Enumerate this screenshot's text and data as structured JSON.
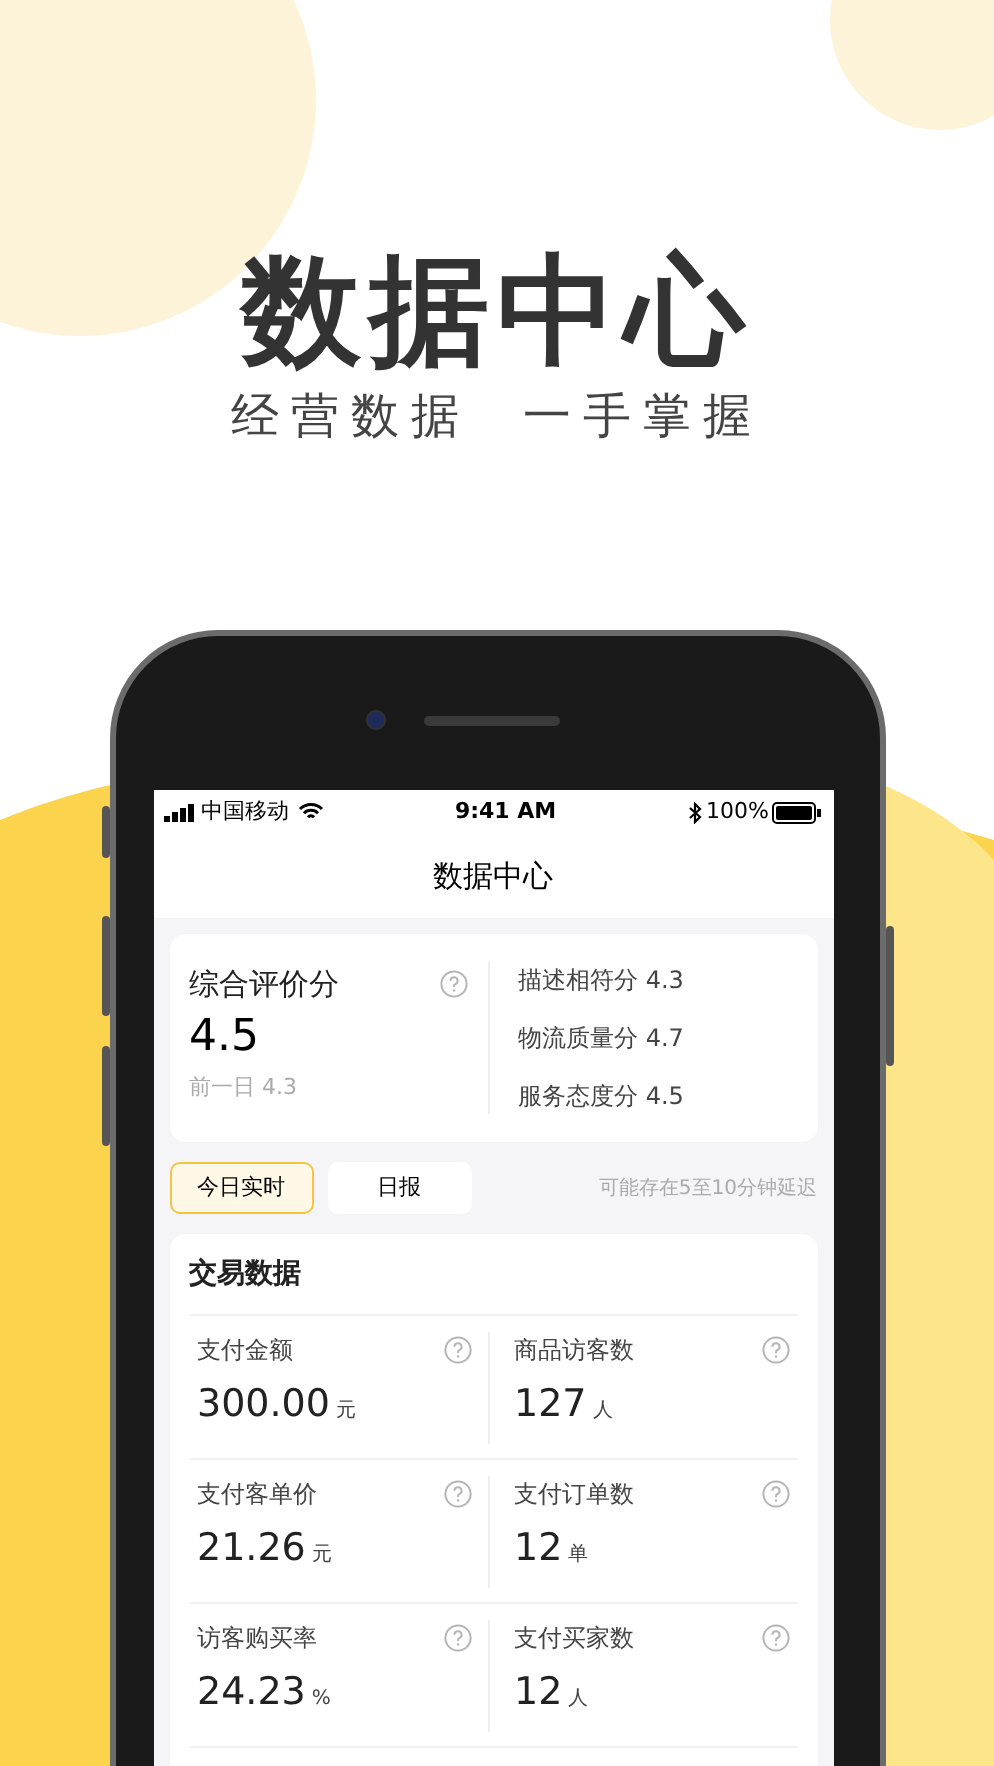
{
  "headline": "数据中心",
  "tagline": [
    "经营数据",
    "一手掌握"
  ],
  "status_bar": {
    "carrier": "中国移动",
    "time": "9:41 AM",
    "battery": "100%"
  },
  "nav_title": "数据中心",
  "rating": {
    "title": "综合评价分",
    "score": "4.5",
    "previous": "前一日 4.3",
    "details": [
      "描述相符分 4.3",
      "物流质量分 4.7",
      "服务态度分 4.5"
    ]
  },
  "tabs": [
    {
      "label": "今日实时",
      "selected": true
    },
    {
      "label": "日报",
      "selected": false
    }
  ],
  "delay_note": "可能存在5至10分钟延迟",
  "trade": {
    "title": "交易数据",
    "metrics": [
      {
        "label": "支付金额",
        "value": "300.00",
        "unit": "元"
      },
      {
        "label": "商品访客数",
        "value": "127",
        "unit": "人"
      },
      {
        "label": "支付客单价",
        "value": "21.26",
        "unit": "元"
      },
      {
        "label": "支付订单数",
        "value": "12",
        "unit": "单"
      },
      {
        "label": "访客购买率",
        "value": "24.23",
        "unit": "%"
      },
      {
        "label": "支付买家数",
        "value": "12",
        "unit": "人"
      }
    ]
  }
}
